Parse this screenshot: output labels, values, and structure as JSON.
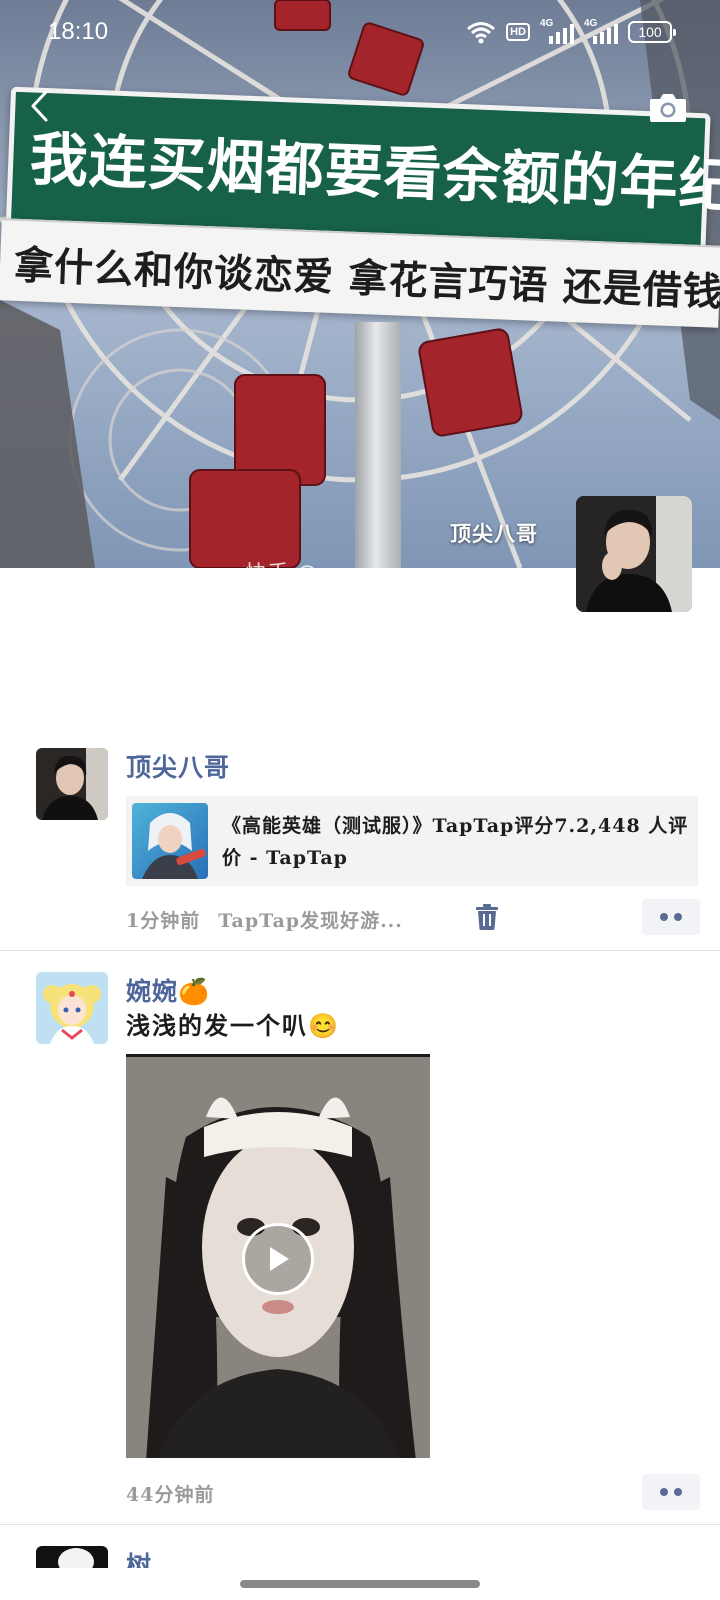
{
  "status_bar": {
    "time": "18:10",
    "hd_label": "HD",
    "signal_1_label": "4G",
    "signal_2_label": "4G",
    "battery": "100"
  },
  "header": {
    "back_icon": "chevron-left-icon",
    "camera_icon": "camera-icon"
  },
  "cover": {
    "sign_main": "我连买烟都要看余额的年纪",
    "sign_sub": "拿什么和你谈恋爱 拿花言巧语 还是借钱陪你",
    "partial_text": "快手 @",
    "user_name": "顶尖八哥"
  },
  "posts": [
    {
      "name": "顶尖八哥",
      "link": {
        "title": "《高能英雄（测试服）》TapTap评分7.2,448 人评价 - TapTap"
      },
      "time": "1分钟前",
      "source": "TapTap发现好游...",
      "delete_icon": "trash-icon",
      "more_icon": "more-dots-icon"
    },
    {
      "name": "婉婉🍊",
      "text": "浅浅的发一个叭😊",
      "time": "44分钟前",
      "play_icon": "play-icon",
      "more_icon": "more-dots-icon"
    },
    {
      "name": "树"
    }
  ],
  "colors": {
    "name_color": "#4e6699",
    "meta_color": "#9a9a9a",
    "card_bg": "#f3f3f3",
    "sign_green": "#17614a"
  }
}
